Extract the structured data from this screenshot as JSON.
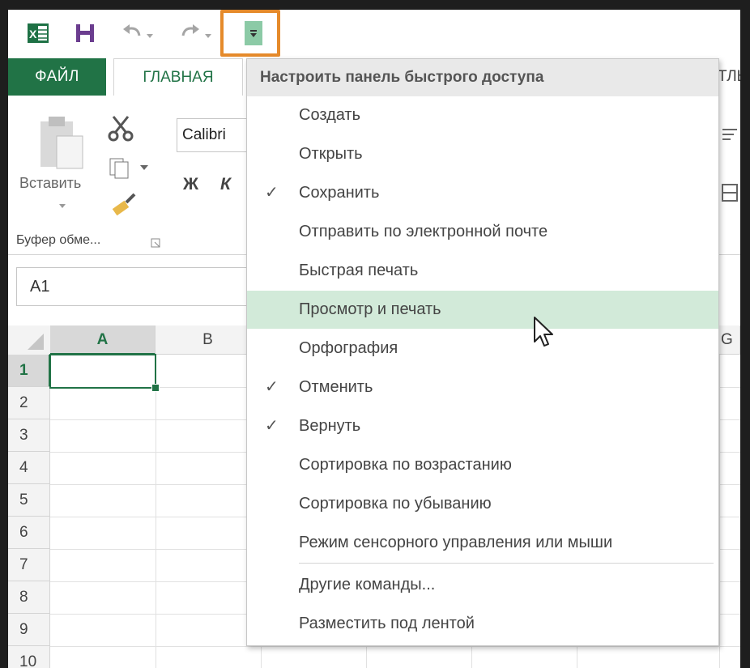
{
  "ribbon": {
    "tab_file": "ФАЙЛ",
    "tab_home": "ГЛАВНАЯ",
    "tab_right_partial": "ТЛЫ",
    "paste_label": "Вставить",
    "clipboard_group": "Буфер обме...",
    "font_name": "Calibri",
    "bold_label": "Ж",
    "italic_label": "К"
  },
  "name_box": "A1",
  "grid": {
    "columns": [
      "A",
      "B"
    ],
    "partial_column": "G",
    "rows": [
      "1",
      "2",
      "3",
      "4",
      "5",
      "6",
      "7",
      "8",
      "9",
      "10"
    ]
  },
  "menu": {
    "header": "Настроить панель быстрого доступа",
    "items": [
      {
        "label": "Создать",
        "checked": false
      },
      {
        "label": "Открыть",
        "checked": false
      },
      {
        "label": "Сохранить",
        "checked": true
      },
      {
        "label": "Отправить по электронной почте",
        "checked": false
      },
      {
        "label": "Быстрая печать",
        "checked": false
      },
      {
        "label": "Просмотр и печать",
        "checked": false,
        "hovered": true
      },
      {
        "label": "Орфография",
        "checked": false
      },
      {
        "label": "Отменить",
        "checked": true
      },
      {
        "label": "Вернуть",
        "checked": true
      },
      {
        "label": "Сортировка по возрастанию",
        "checked": false
      },
      {
        "label": "Сортировка по убыванию",
        "checked": false
      },
      {
        "label": "Режим сенсорного управления или мыши",
        "checked": false
      },
      {
        "label": "Другие команды...",
        "checked": false
      },
      {
        "label": "Разместить под лентой",
        "checked": false
      }
    ],
    "check_glyph": "✓"
  },
  "colors": {
    "excel_green": "#217346",
    "highlight": "#e58a2b",
    "menu_hover": "#d2ead9"
  }
}
